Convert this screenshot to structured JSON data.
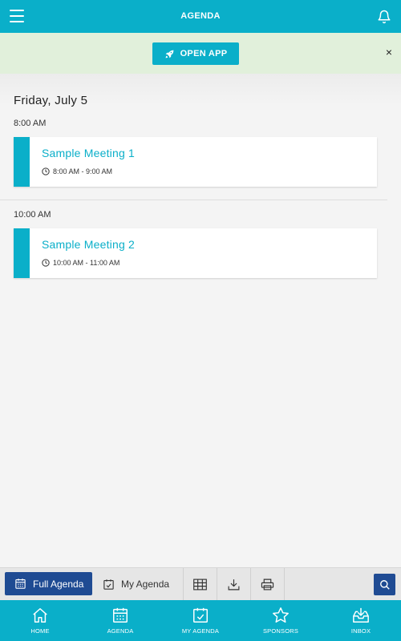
{
  "header": {
    "title": "AGENDA",
    "menu_icon": "hamburger-icon",
    "bell_icon": "bell-icon"
  },
  "banner": {
    "button_label": "OPEN APP",
    "close_label": "×"
  },
  "agenda": {
    "day": "Friday, July 5",
    "slots": [
      {
        "time": "8:00 AM",
        "meeting": {
          "name": "Sample Meeting 1",
          "time_range": "8:00 AM - 9:00 AM"
        }
      },
      {
        "time": "10:00 AM",
        "meeting": {
          "name": "Sample Meeting 2",
          "time_range": "10:00 AM - 11:00 AM"
        }
      }
    ]
  },
  "toolbar": {
    "full_agenda": "Full Agenda",
    "my_agenda": "My Agenda",
    "icons": [
      "grid-icon",
      "download-icon",
      "print-icon",
      "search-icon"
    ]
  },
  "bottom_nav": [
    {
      "label": "HOME",
      "icon": "home-icon"
    },
    {
      "label": "AGENDA",
      "icon": "calendar-icon"
    },
    {
      "label": "MY AGENDA",
      "icon": "calendar-check-icon"
    },
    {
      "label": "SPONSORS",
      "icon": "star-icon"
    },
    {
      "label": "INBOX",
      "icon": "inbox-icon"
    }
  ],
  "colors": {
    "accent": "#0aafc9",
    "primary_dark": "#1f4b93",
    "banner_bg": "#e1f0db",
    "page_bg": "#f4f4f4"
  }
}
